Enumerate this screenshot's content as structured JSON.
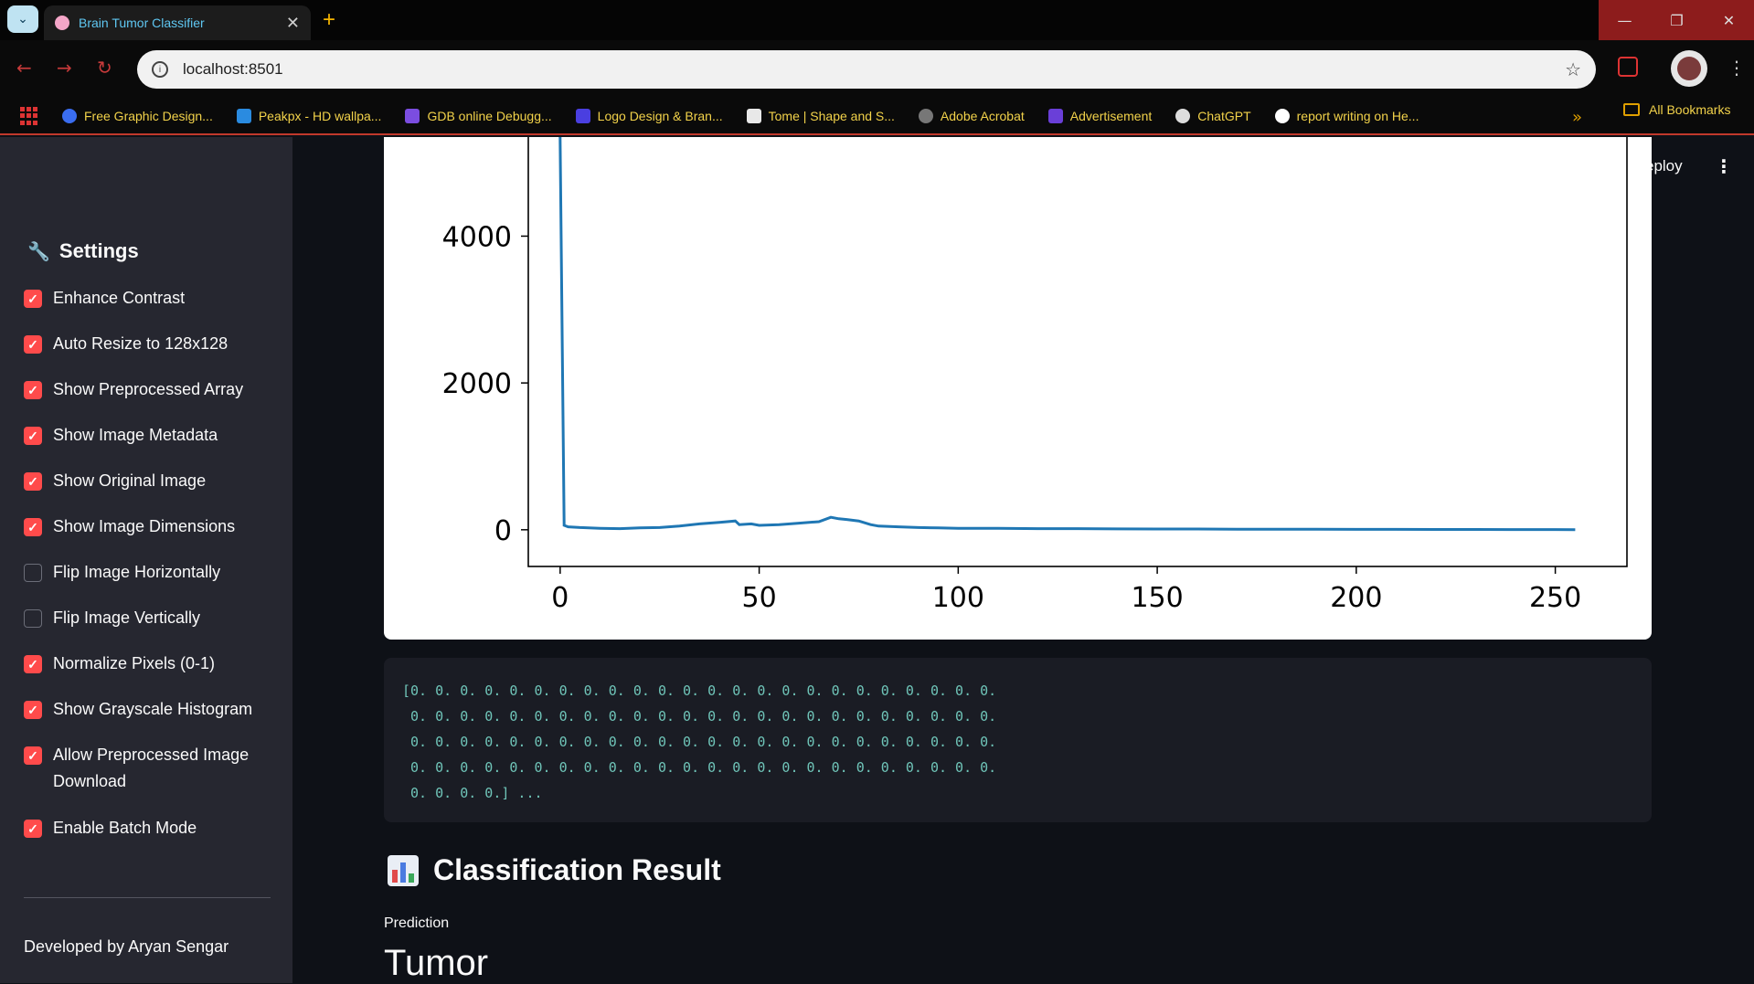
{
  "browser": {
    "tab_title": "Brain Tumor Classifier",
    "url": "localhost:8501",
    "new_tab_symbol": "+",
    "bookmarks": [
      {
        "label": "Free Graphic Design...",
        "color": "#3a6df0"
      },
      {
        "label": "Peakpx - HD wallpa...",
        "color": "#2a8be0"
      },
      {
        "label": "GDB online Debugg...",
        "color": "#7b4de0"
      },
      {
        "label": "Logo Design & Bran...",
        "color": "#4a3fe0"
      },
      {
        "label": "Tome | Shape and S...",
        "color": "#e8e8e8"
      },
      {
        "label": "Adobe Acrobat",
        "color": "#777777"
      },
      {
        "label": "Advertisement",
        "color": "#6a3fd8"
      },
      {
        "label": "ChatGPT",
        "color": "#dddddd"
      },
      {
        "label": "report writing on He...",
        "color": "#ffffff"
      }
    ],
    "more_bookmarks": "»",
    "all_bookmarks": "All Bookmarks"
  },
  "sidebar": {
    "title": "Settings",
    "options": [
      {
        "label": "Enhance Contrast",
        "checked": true
      },
      {
        "label": "Auto Resize to 128x128",
        "checked": true
      },
      {
        "label": "Show Preprocessed Array",
        "checked": true
      },
      {
        "label": "Show Image Metadata",
        "checked": true
      },
      {
        "label": "Show Original Image",
        "checked": true
      },
      {
        "label": "Show Image Dimensions",
        "checked": true
      },
      {
        "label": "Flip Image Horizontally",
        "checked": false
      },
      {
        "label": "Flip Image Vertically",
        "checked": false
      },
      {
        "label": "Normalize Pixels (0-1)",
        "checked": true
      },
      {
        "label": "Show Grayscale Histogram",
        "checked": true
      },
      {
        "label": "Allow Preprocessed Image Download",
        "checked": true
      },
      {
        "label": "Enable Batch Mode",
        "checked": true
      }
    ],
    "footer": "Developed by Aryan Sengar"
  },
  "header": {
    "deploy_label": "eploy"
  },
  "chart_data": {
    "type": "line",
    "title": "",
    "xlabel": "",
    "ylabel": "",
    "xlim": [
      -8,
      268
    ],
    "ylim": [
      -500,
      5350
    ],
    "xticks": [
      0,
      50,
      100,
      150,
      200,
      250
    ],
    "yticks": [
      0,
      2000,
      4000
    ],
    "series": [
      {
        "color": "#1f77b4",
        "x": [
          0,
          1,
          2,
          5,
          10,
          15,
          20,
          25,
          30,
          35,
          40,
          44,
          45,
          48,
          50,
          55,
          60,
          65,
          68,
          70,
          72,
          75,
          78,
          80,
          85,
          90,
          95,
          100,
          110,
          120,
          130,
          140,
          150,
          160,
          170,
          180,
          190,
          200,
          210,
          220,
          230,
          240,
          250,
          255
        ],
        "y": [
          5400,
          60,
          40,
          30,
          20,
          15,
          25,
          30,
          50,
          80,
          100,
          120,
          70,
          80,
          60,
          70,
          90,
          110,
          170,
          150,
          140,
          120,
          70,
          50,
          40,
          30,
          25,
          20,
          20,
          15,
          15,
          12,
          10,
          10,
          8,
          8,
          6,
          5,
          5,
          4,
          4,
          3,
          3,
          2
        ]
      }
    ]
  },
  "array_output": {
    "lines": [
      "[0. 0. 0. 0. 0. 0. 0. 0. 0. 0. 0. 0. 0. 0. 0. 0. 0. 0. 0. 0. 0. 0. 0. 0.",
      " 0. 0. 0. 0. 0. 0. 0. 0. 0. 0. 0. 0. 0. 0. 0. 0. 0. 0. 0. 0. 0. 0. 0. 0.",
      " 0. 0. 0. 0. 0. 0. 0. 0. 0. 0. 0. 0. 0. 0. 0. 0. 0. 0. 0. 0. 0. 0. 0. 0.",
      " 0. 0. 0. 0. 0. 0. 0. 0. 0. 0. 0. 0. 0. 0. 0. 0. 0. 0. 0. 0. 0. 0. 0. 0.",
      " 0. 0. 0. 0.] ..."
    ]
  },
  "result": {
    "title": "Classification Result",
    "prediction_label": "Prediction",
    "prediction_value": "Tumor"
  }
}
